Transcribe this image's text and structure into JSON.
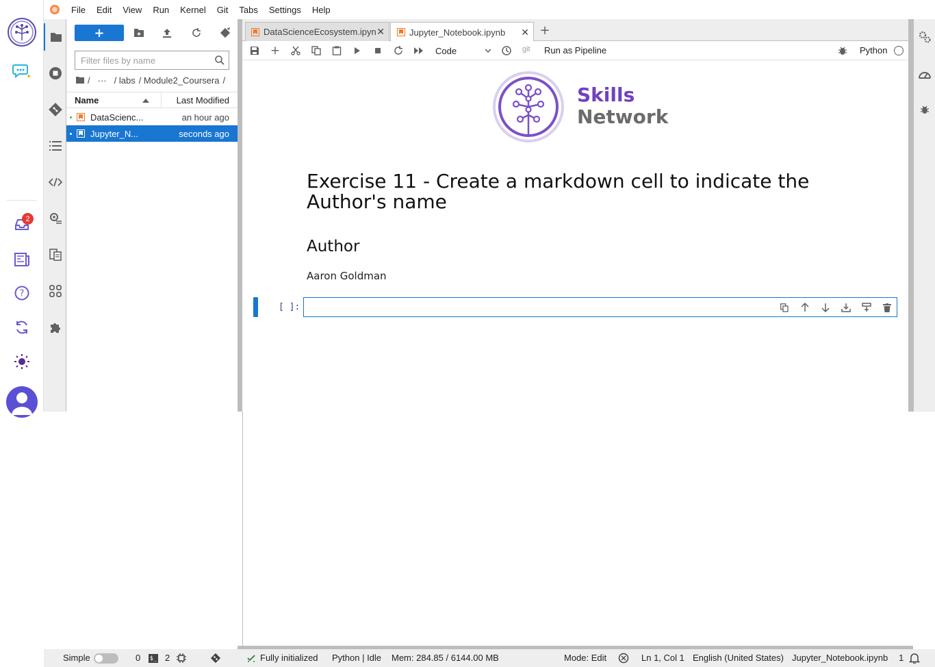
{
  "menu": [
    "File",
    "Edit",
    "View",
    "Run",
    "Kernel",
    "Git",
    "Tabs",
    "Settings",
    "Help"
  ],
  "rail": {
    "inbox_badge": "2"
  },
  "filebrowser": {
    "new_label": "+",
    "filter_placeholder": "Filter files by name",
    "breadcrumb": [
      "/",
      "···",
      "/ labs",
      "/ Module2_Coursera",
      "/"
    ],
    "col_name": "Name",
    "col_modified": "Last Modified",
    "files": [
      {
        "name": "DataScienc...",
        "modified": "an hour ago",
        "selected": false
      },
      {
        "name": "Jupyter_N...",
        "modified": "seconds ago",
        "selected": true
      }
    ]
  },
  "tabs": [
    {
      "label": "DataScienceEcosystem.ipyn",
      "active": false
    },
    {
      "label": "Jupyter_Notebook.ipynb",
      "active": true
    }
  ],
  "toolbar": {
    "cell_type": "Code",
    "git_label": "git",
    "pipeline_label": "Run as Pipeline",
    "kernel_name": "Python"
  },
  "notebook": {
    "logo_line1": "Skills",
    "logo_line2": "Network",
    "heading": "Exercise 11 - Create a markdown cell to indicate the Author's name",
    "subheading": "Author",
    "author": "Aaron Goldman",
    "prompt": "[ ]:"
  },
  "status": {
    "mode_simple": "Simple",
    "terminals": "0",
    "kernels": "2",
    "init": "Fully initialized",
    "kernel_state": "Python | Idle",
    "mem": "Mem: 284.85 / 6144.00 MB",
    "mode": "Mode: Edit",
    "cursor": "Ln 1, Col 1",
    "language": "English (United States)",
    "filename": "Jupyter_Notebook.ipynb",
    "notifications": "1"
  },
  "colors": {
    "accent": "#1976d2",
    "brand_purple": "#6f42c1",
    "badge_red": "#e53935"
  }
}
